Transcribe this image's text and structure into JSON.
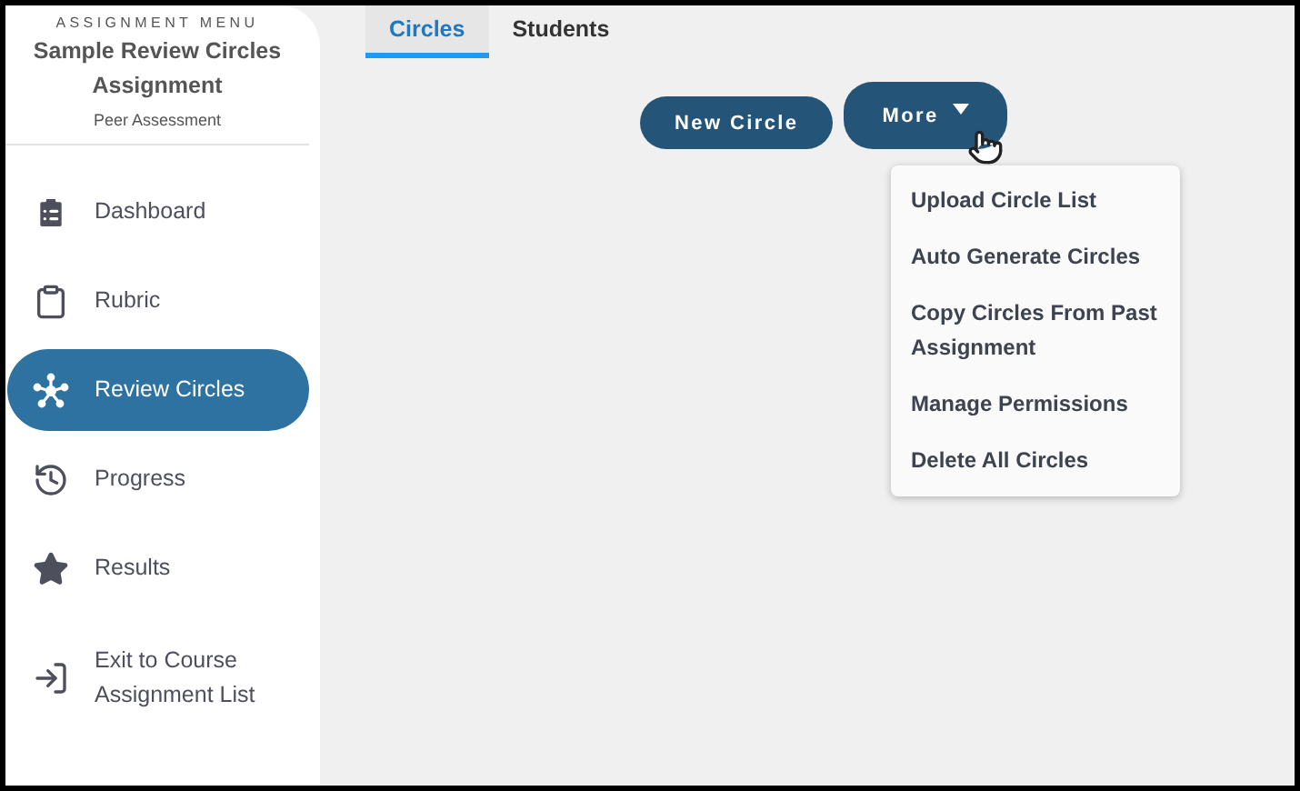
{
  "sidebar": {
    "heading": "ASSIGNMENT MENU",
    "title": "Sample Review Circles Assignment",
    "subtitle": "Peer Assessment",
    "items": [
      {
        "kind": "dashboard",
        "label": "Dashboard",
        "selected": false
      },
      {
        "kind": "rubric",
        "label": "Rubric",
        "selected": false
      },
      {
        "kind": "circles",
        "label": "Review Circles",
        "selected": true
      },
      {
        "kind": "progress",
        "label": "Progress",
        "selected": false
      },
      {
        "kind": "results",
        "label": "Results",
        "selected": false
      },
      {
        "kind": "exit",
        "label": "Exit to Course Assignment List",
        "selected": false
      }
    ]
  },
  "tabs": [
    {
      "label": "Circles",
      "selected": true
    },
    {
      "label": "Students",
      "selected": false
    }
  ],
  "buttons": {
    "new": "New Circle",
    "more": "More"
  },
  "menu": {
    "expanded": true,
    "items": [
      "Upload Circle List",
      "Auto Generate Circles",
      "Copy Circles From Past Assignment",
      "Manage Permissions",
      "Delete All Circles"
    ]
  }
}
